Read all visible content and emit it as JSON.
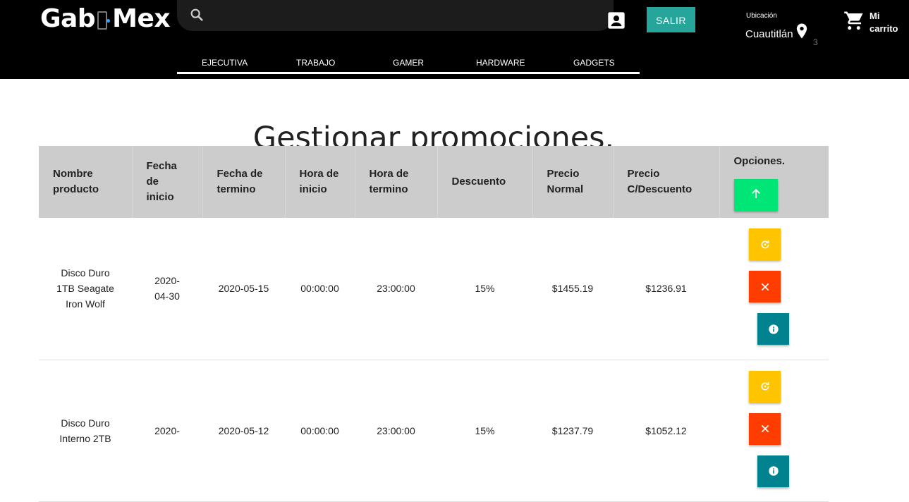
{
  "header": {
    "logo_left": "Gab",
    "logo_right": "Mex",
    "search_placeholder": "",
    "logout_label": "SALIR",
    "location_label": "Ubicación",
    "location_value": "Cuautitlán",
    "cart_count": "3",
    "cart_label": "Mi carrito",
    "icons": [
      "search-icon",
      "account-box-icon",
      "location-pin-icon",
      "shopping-cart-icon"
    ]
  },
  "nav": {
    "items": [
      "EJECUTIVA",
      "TRABAJO",
      "GAMER",
      "HARDWARE",
      "GADGETS"
    ]
  },
  "page": {
    "title": "Gestionar promociones."
  },
  "table": {
    "headers": [
      "Nombre producto",
      "Fecha de inicio",
      "Fecha de termino",
      "Hora de inicio",
      "Hora de termino",
      "Descuento",
      "Precio Normal",
      "Precio C/Descuento",
      "Opciones."
    ],
    "rows": [
      {
        "nombre": "Disco Duro 1TB Seagate Iron Wolf",
        "fecha_inicio": "2020-04-30",
        "fecha_termino": "2020-05-15",
        "hora_inicio": "00:00:00",
        "hora_termino": "23:00:00",
        "descuento": "15%",
        "precio_normal": "$1455.19",
        "precio_descuento": "$1236.91"
      },
      {
        "nombre": "Disco Duro Interno 2TB",
        "fecha_inicio": "2020-",
        "fecha_termino": "2020-05-12",
        "hora_inicio": "00:00:00",
        "hora_termino": "23:00:00",
        "descuento": "15%",
        "precio_normal": "$1237.79",
        "precio_descuento": "$1052.12"
      }
    ]
  },
  "colors": {
    "header_bg": "#000000",
    "logout_button": "#26a69a",
    "table_header_bg": "#cccccc",
    "add_button": "#00e676",
    "edit_button": "#ffc400",
    "delete_button": "#ff3d00",
    "info_button": "#00838f"
  }
}
